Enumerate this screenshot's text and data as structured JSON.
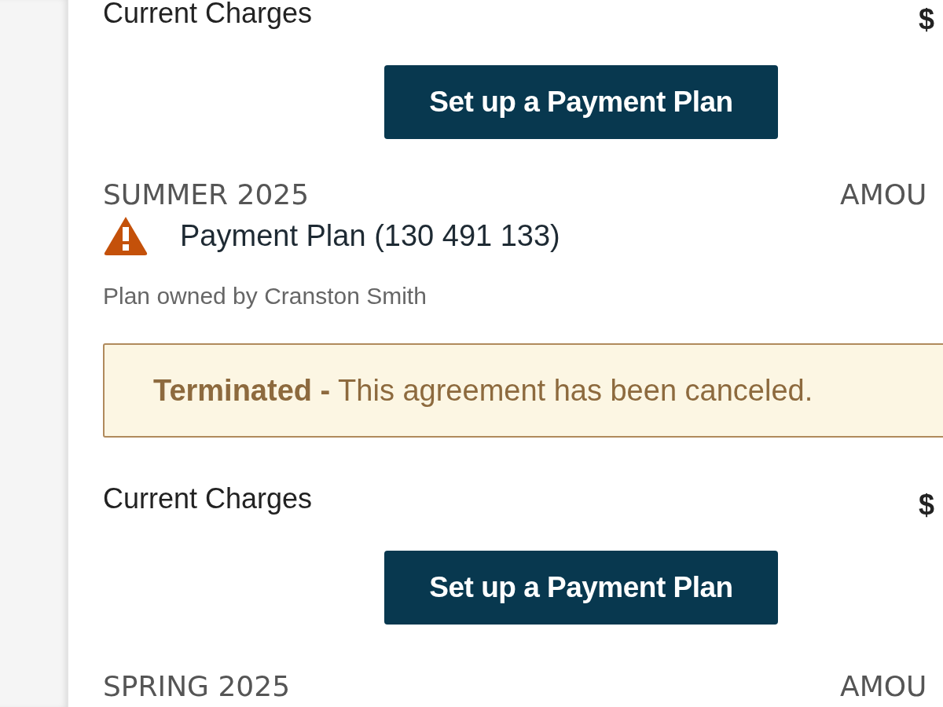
{
  "top_charges": {
    "label": "Current Charges",
    "amount": "$",
    "button": "Set up a Payment Plan"
  },
  "term": {
    "title": "SUMMER 2025",
    "amount_header": "AMOU",
    "plan": {
      "title": "Payment Plan (130 491 133)",
      "warning": true,
      "owner": "Plan owned by Cranston Smith"
    },
    "alert": "**Terminated -** This agreement has been canceled.",
    "charges": {
      "label": "Current Charges",
      "amount": "$",
      "button": "Set up a Payment Plan"
    }
  },
  "next_term": {
    "title": "SPRING 2025",
    "amount_header": "AMOU"
  }
}
